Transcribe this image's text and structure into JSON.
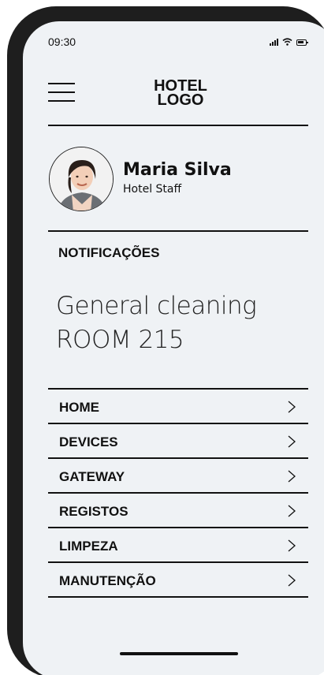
{
  "status_bar": {
    "time": "09:30"
  },
  "header": {
    "logo_line1": "HOTEL",
    "logo_line2": "LOGO"
  },
  "user": {
    "name": "Maria Silva",
    "role": "Hotel Staff"
  },
  "notifications": {
    "title": "NOTIFICAÇÕES",
    "message_line1": "General cleaning",
    "message_line2": "ROOM 215"
  },
  "menu": {
    "items": [
      {
        "label": "HOME"
      },
      {
        "label": "DEVICES"
      },
      {
        "label": "GATEWAY"
      },
      {
        "label": "REGISTOS"
      },
      {
        "label": "LIMPEZA"
      },
      {
        "label": "MANUTENÇÃO"
      }
    ]
  },
  "icons": {
    "menu": "hamburger-menu-icon",
    "chevron": "chevron-right-icon",
    "signal": "signal-icon",
    "wifi": "wifi-icon",
    "battery": "battery-icon"
  }
}
